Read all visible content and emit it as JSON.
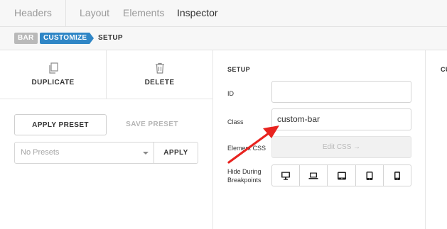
{
  "topnav": {
    "tabs": [
      "Headers",
      "Layout",
      "Elements",
      "Inspector"
    ],
    "active": "Inspector"
  },
  "breadcrumb": {
    "items": [
      "BAR",
      "CUSTOMIZE",
      "SETUP"
    ]
  },
  "left_panel": {
    "duplicate_label": "DUPLICATE",
    "delete_label": "DELETE",
    "apply_preset_label": "APPLY PRESET",
    "save_preset_label": "SAVE PRESET",
    "presets_select_value": "No Presets",
    "apply_label": "APPLY"
  },
  "setup_panel": {
    "title": "SETUP",
    "id_label": "ID",
    "id_value": "",
    "class_label": "Class",
    "class_value": "custom-bar",
    "element_css_label": "Element CSS",
    "edit_css_label": "Edit CSS →",
    "hide_breakpoints_label_1": "Hide During",
    "hide_breakpoints_label_2": "Breakpoints",
    "breakpoints": [
      "desktop-icon",
      "laptop-icon",
      "tablet-landscape-icon",
      "tablet-portrait-icon",
      "phone-icon"
    ]
  },
  "right_panel": {
    "title_fragment": "CU"
  },
  "colors": {
    "accent": "#2f86c6",
    "crumb_gray": "#b9b9b9",
    "annotation_arrow": "#e8231f"
  }
}
